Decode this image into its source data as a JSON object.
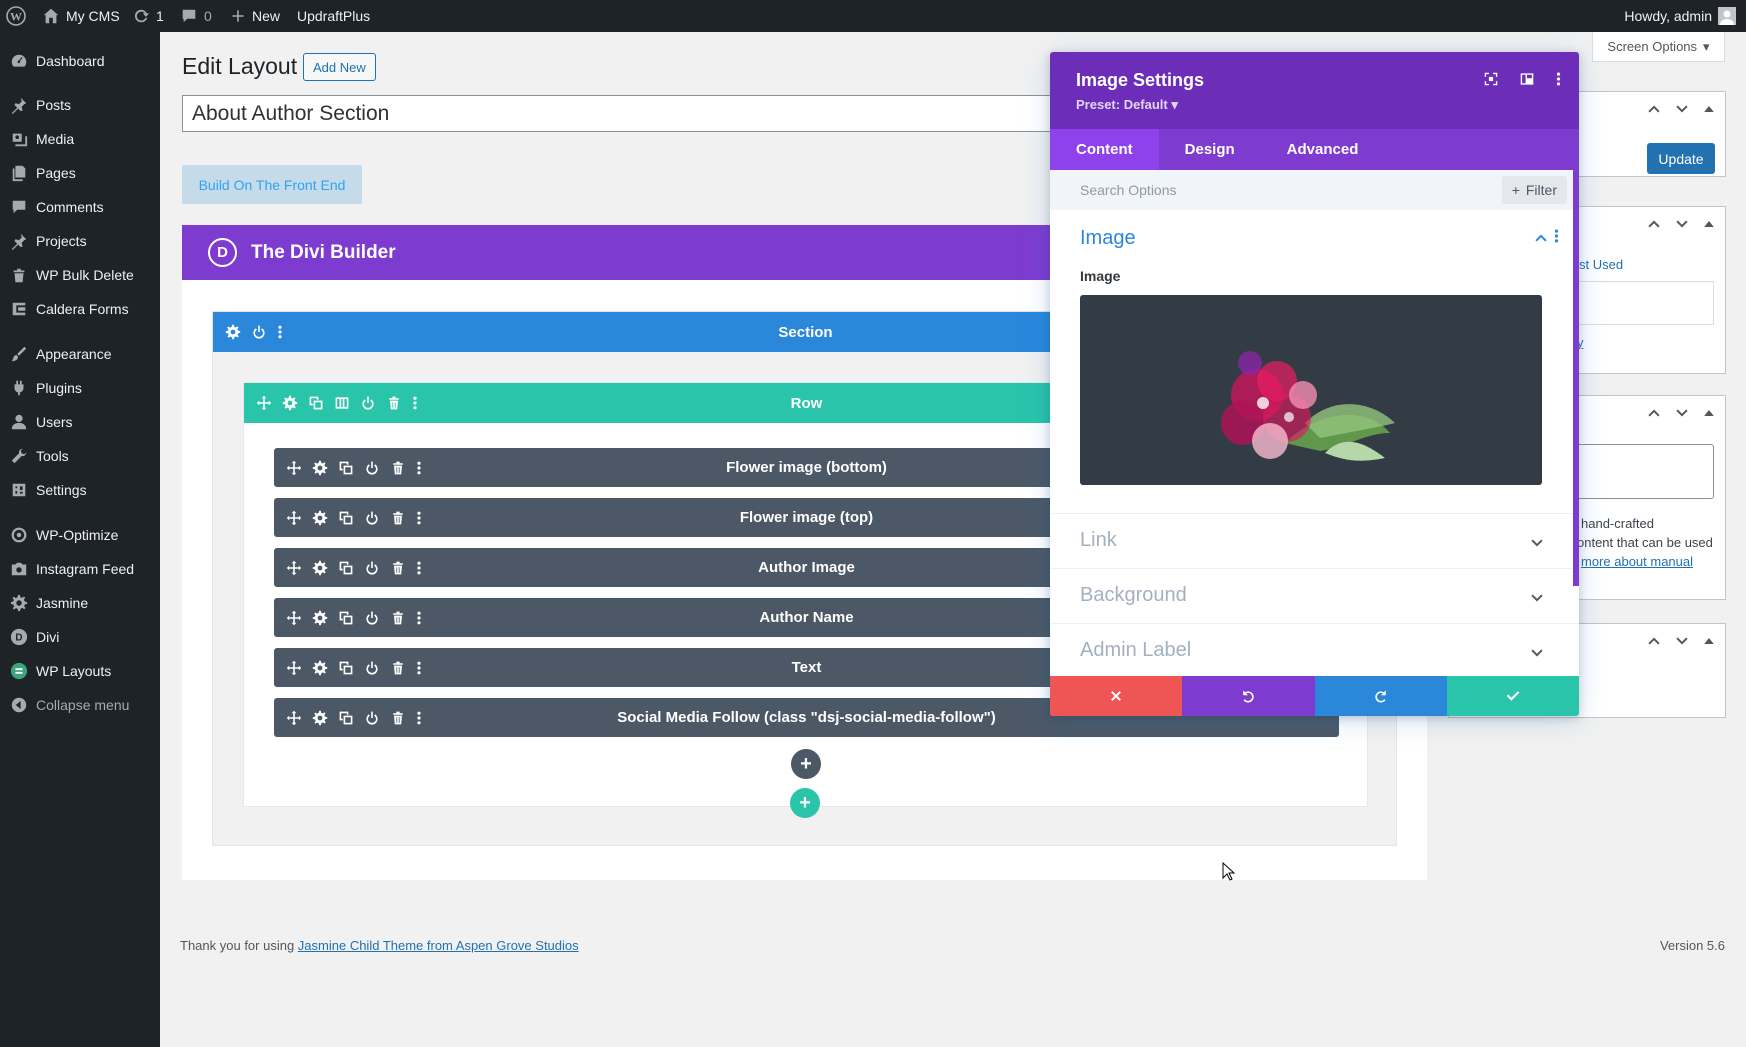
{
  "adminbar": {
    "site_name": "My CMS",
    "updates_count": "1",
    "comments_count": "0",
    "new_label": "New",
    "plugin_link": "UpdraftPlus",
    "howdy": "Howdy, admin"
  },
  "sidebar": {
    "items": [
      {
        "label": "Dashboard",
        "icon": "dashboard-icon"
      },
      {
        "label": "Posts",
        "icon": "pin-icon"
      },
      {
        "label": "Media",
        "icon": "media-icon"
      },
      {
        "label": "Pages",
        "icon": "pages-icon"
      },
      {
        "label": "Comments",
        "icon": "comment-icon"
      },
      {
        "label": "Projects",
        "icon": "pin-icon"
      },
      {
        "label": "WP Bulk Delete",
        "icon": "trash-icon"
      },
      {
        "label": "Caldera Forms",
        "icon": "caldera-icon"
      },
      {
        "label": "Appearance",
        "icon": "brush-icon"
      },
      {
        "label": "Plugins",
        "icon": "plug-icon"
      },
      {
        "label": "Users",
        "icon": "user-icon"
      },
      {
        "label": "Tools",
        "icon": "wrench-icon"
      },
      {
        "label": "Settings",
        "icon": "settings-icon"
      },
      {
        "label": "WP-Optimize",
        "icon": "optimize-icon"
      },
      {
        "label": "Instagram Feed",
        "icon": "camera-icon"
      },
      {
        "label": "Jasmine",
        "icon": "gear-icon"
      },
      {
        "label": "Divi",
        "icon": "divi-icon"
      },
      {
        "label": "WP Layouts",
        "icon": "layouts-icon"
      },
      {
        "label": "Collapse menu",
        "icon": "collapse-icon"
      }
    ]
  },
  "main": {
    "heading": "Edit Layout",
    "add_new": "Add New",
    "title_value": "About Author Section",
    "build_front": "Build On The Front End",
    "divi_title": "The Divi Builder",
    "divi_logo_letter": "D",
    "section_label": "Section",
    "row_label": "Row",
    "modules": [
      "Flower image (bottom)",
      "Flower image (top)",
      "Author Image",
      "Author Name",
      "Text",
      "Social Media Follow (class \"dsj-social-media-follow\")"
    ]
  },
  "metaboxes": {
    "screen_options": "Screen Options",
    "update": "Update",
    "most_used_fragment": "st Used",
    "link_fragment": "y",
    "desc_line1": "hand-crafted",
    "desc_line2": "ontent that can be used",
    "desc_link": "more about manual"
  },
  "modal": {
    "title": "Image Settings",
    "preset": "Preset: Default",
    "tabs": [
      "Content",
      "Design",
      "Advanced"
    ],
    "search_placeholder": "Search Options",
    "filter_label": "Filter",
    "groups": [
      "Image",
      "Link",
      "Background",
      "Admin Label"
    ],
    "image_field_label": "Image"
  },
  "footer": {
    "thanks": "Thank you for using ",
    "theme_link": "Jasmine Child Theme from Aspen Grove Studios",
    "version": "Version 5.6"
  },
  "colors": {
    "divi_purple": "#7e3bd0",
    "section_blue": "#2b87da",
    "row_teal": "#29c4a9",
    "module_gray": "#4c5866",
    "discard_red": "#ef5555",
    "save_green": "#29c4a9"
  }
}
